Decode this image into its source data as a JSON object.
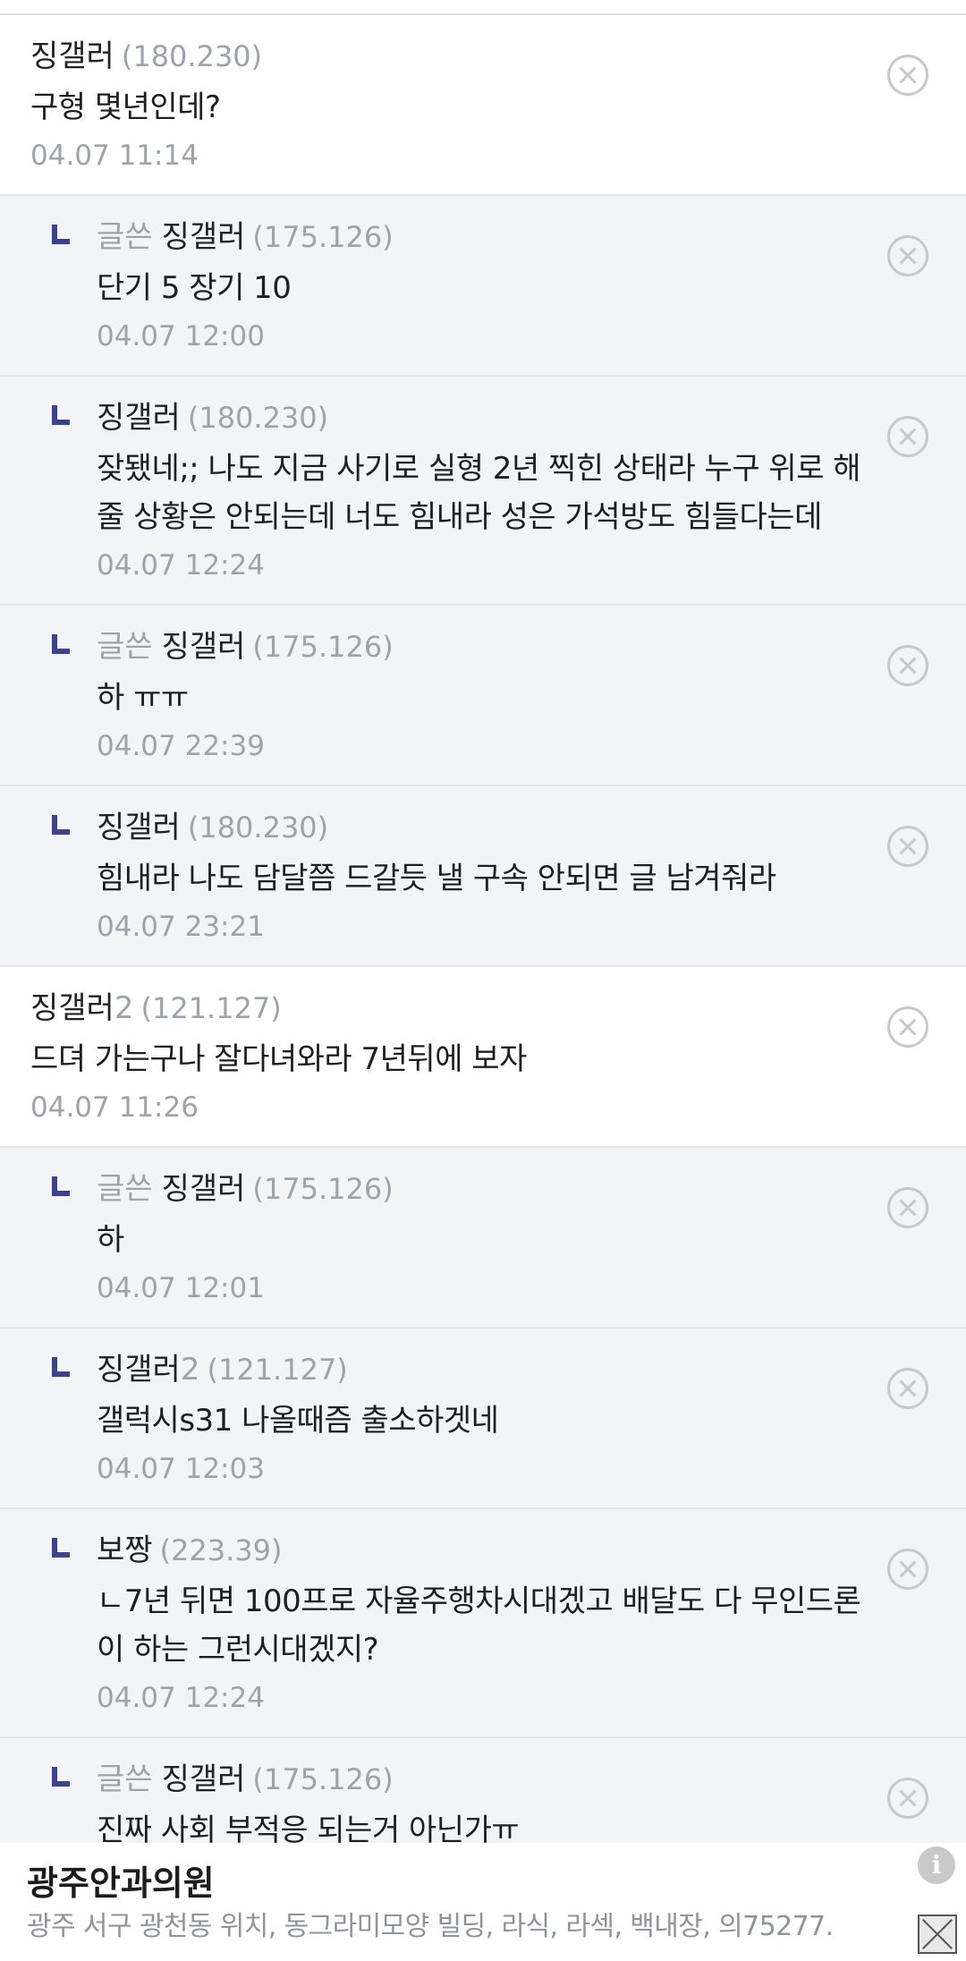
{
  "comments": [
    {
      "reply": false,
      "author_badge": "",
      "nick": "징갤러",
      "nick_suffix": "",
      "ip": "(180.230)",
      "text": "구형 몇년인데?",
      "date": "04.07 11:14"
    },
    {
      "reply": true,
      "author_badge": "글쓴",
      "nick": "징갤러",
      "nick_suffix": "",
      "ip": "(175.126)",
      "text": "단기 5 장기 10",
      "date": "04.07 12:00"
    },
    {
      "reply": true,
      "author_badge": "",
      "nick": "징갤러",
      "nick_suffix": "",
      "ip": "(180.230)",
      "text": "잦됐네;; 나도 지금 사기로 실형 2년 찍힌 상태라 누구 위로 해줄 상황은 안되는데 너도 힘내라 성은 가석방도 힘들다는데",
      "date": "04.07 12:24"
    },
    {
      "reply": true,
      "author_badge": "글쓴",
      "nick": "징갤러",
      "nick_suffix": "",
      "ip": "(175.126)",
      "text": "하 ㅠㅠ",
      "date": "04.07 22:39"
    },
    {
      "reply": true,
      "author_badge": "",
      "nick": "징갤러",
      "nick_suffix": "",
      "ip": "(180.230)",
      "text": "힘내라 나도 담달쯤 드갈듯 낼 구속 안되면 글 남겨줘라",
      "date": "04.07 23:21"
    },
    {
      "reply": false,
      "author_badge": "",
      "nick": "징갤러",
      "nick_suffix": "2",
      "ip": "(121.127)",
      "text": "드뎌 가는구나 잘다녀와라 7년뒤에 보자",
      "date": "04.07 11:26"
    },
    {
      "reply": true,
      "author_badge": "글쓴",
      "nick": "징갤러",
      "nick_suffix": "",
      "ip": "(175.126)",
      "text": "하",
      "date": "04.07 12:01"
    },
    {
      "reply": true,
      "author_badge": "",
      "nick": "징갤러",
      "nick_suffix": "2",
      "ip": "(121.127)",
      "text": "갤럭시s31 나올때즘 출소하겟네",
      "date": "04.07 12:03"
    },
    {
      "reply": true,
      "author_badge": "",
      "nick": "보짱",
      "nick_suffix": "",
      "ip": "(223.39)",
      "text": "ㄴ7년 뒤면 100프로 자율주행차시대겠고 배달도 다 무인드론이 하는 그런시대겠지?",
      "date": "04.07 12:24"
    },
    {
      "reply": true,
      "author_badge": "글쓴",
      "nick": "징갤러",
      "nick_suffix": "",
      "ip": "(175.126)",
      "text": "진짜 사회 부적응 되는거 아닌가ㅠ",
      "date": ""
    }
  ],
  "ad": {
    "title": "광주안과의원",
    "desc": "광주 서구 광천동 위치, 동그라미모양 빌딩, 라식, 라섹, 백내장, 의75277.",
    "info_icon": "info-icon",
    "close_icon": "close-icon"
  }
}
